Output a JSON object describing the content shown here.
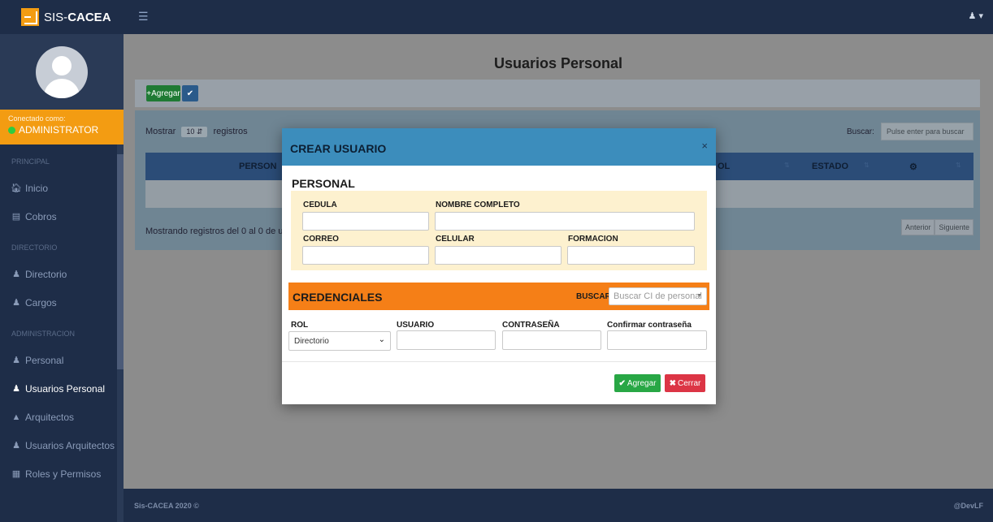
{
  "brand": {
    "prefix": "SIS-",
    "name": "CACEA"
  },
  "topbar": {
    "menu_icon": "hamburger-icon",
    "user_icon": "user-icon",
    "user_caret": "▾"
  },
  "sidebar": {
    "connected_label": "Conectado como:",
    "connected_user": "ADMINISTRATOR",
    "sections": {
      "principal": "PRINCIPAL",
      "directorio": "DIRECTORIO",
      "administracion": "ADMINISTRACION"
    },
    "items": {
      "inicio": "Inicio",
      "cobros": "Cobros",
      "directorio": "Directorio",
      "cargos": "Cargos",
      "personal": "Personal",
      "usuarios_personal": "Usuarios Personal",
      "arquitectos": "Arquitectos",
      "usuarios_arquitectos": "Usuarios Arquitectos",
      "roles_permisos": "Roles y Permisos"
    }
  },
  "page": {
    "title": "Usuarios Personal",
    "add_label": "Agregar",
    "table": {
      "show_prefix": "Mostrar",
      "show_value": "10",
      "show_suffix": "registros",
      "search_label": "Buscar:",
      "search_placeholder": "Pulse enter para buscar",
      "headers": {
        "personal": "PERSON",
        "rol": "OL",
        "estado": "ESTADO"
      },
      "info": "Mostrando registros del 0 al 0 de un",
      "prev": "Anterior",
      "next": "Siguiente"
    }
  },
  "footer": {
    "left": "Sis-CACEA 2020 ©",
    "right": "@DevLF"
  },
  "modal": {
    "title": "CREAR USUARIO",
    "close": "×",
    "personal_title": "PERSONAL",
    "fields": {
      "cedula": "CEDULA",
      "nombre": "NOMBRE COMPLETO",
      "correo": "CORREO",
      "celular": "CELULAR",
      "formacion": "FORMACION"
    },
    "credentials_title": "CREDENCIALES",
    "buscar_label": "BUSCAR",
    "buscar_placeholder": "Buscar CI de personal",
    "cred_fields": {
      "rol": "ROL",
      "usuario": "USUARIO",
      "password": "CONTRASEÑA",
      "confirm": "Confirmar contraseña"
    },
    "rol_value": "Directorio",
    "agregar": "Agregar",
    "cerrar": "Cerrar"
  },
  "colors": {
    "navbar": "#1e2d48",
    "accent_orange": "#f57f17",
    "modal_header": "#3c8dbc",
    "success": "#28a745",
    "danger": "#dc3545"
  }
}
